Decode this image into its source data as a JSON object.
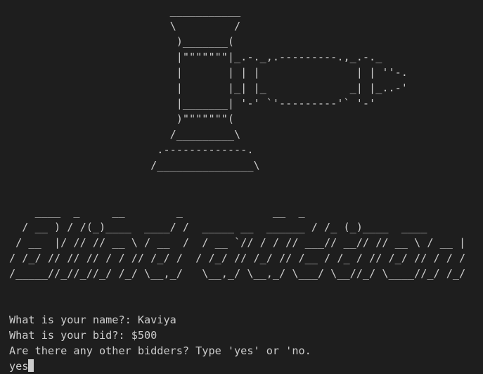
{
  "terminal": {
    "gavel_art": [
      "                         ___________",
      "                         \\         /",
      "                          )_______(",
      "                          |\"\"\"\"\"\"\"|_.-._,.---------.,_.-._",
      "                          |       | | |               | | ''-.",
      "                          |       |_| |_             _| |_..-'",
      "                          |_______| '-' `'---------'` '-'",
      "                          )\"\"\"\"\"\"\"(",
      "                         /_________\\",
      "                       .-------------.",
      "                      /_______________\\"
    ],
    "title_art": [
      "    ____  _     __        _              __  _",
      "  / __ ) / /(_)____  ____/ /  _____ __  ______ / /_ (_)____  ____",
      " / __  |/ // // __ \\ / __  /  / __ `// / / // ___// __// // __ \\ / __ |",
      "/ /_/ // // // / / // /_/ /  / /_/ // /_/ // /__ / /_ / // /_/ // / / /",
      "/_____//_//_//_/ /_/ \\__,_/   \\__,_/ \\__,_/ \\___/ \\__//_/ \\____//_/ /_/"
    ],
    "lines": [
      "What is your name?: Kaviya",
      "What is your bid?: $500",
      "Are there any other bidders? Type 'yes' or 'no.",
      "yes"
    ],
    "cursor_color": "#cccccc",
    "background_color": "#1e1e1e",
    "text_color": "#cccccc"
  }
}
